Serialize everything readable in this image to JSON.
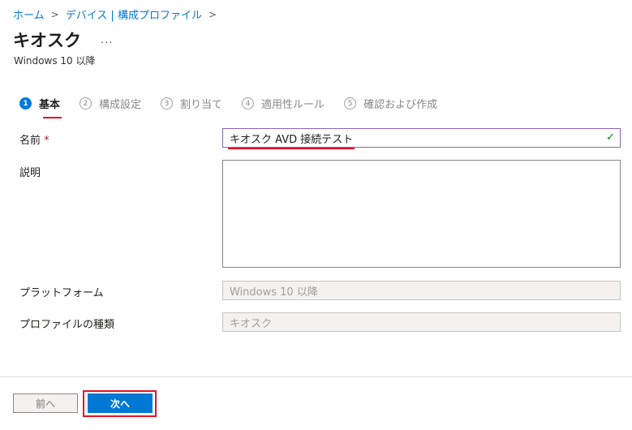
{
  "breadcrumb": {
    "items": [
      "ホーム",
      "デバイス | 構成プロファイル"
    ],
    "separator": ">"
  },
  "header": {
    "title": "キオスク",
    "more": "...",
    "subtitle": "Windows 10 以降"
  },
  "steps": [
    {
      "num": "1",
      "label": "基本",
      "active": true
    },
    {
      "num": "2",
      "label": "構成設定",
      "active": false
    },
    {
      "num": "3",
      "label": "割り当て",
      "active": false
    },
    {
      "num": "4",
      "label": "適用性ルール",
      "active": false
    },
    {
      "num": "5",
      "label": "確認および作成",
      "active": false
    }
  ],
  "form": {
    "name_label": "名前",
    "required_mark": "*",
    "name_value": "キオスク AVD 接続テスト",
    "valid_check": "✓",
    "description_label": "説明",
    "description_value": "",
    "platform_label": "プラットフォーム",
    "platform_value": "Windows 10 以降",
    "profile_type_label": "プロファイルの種類",
    "profile_type_value": "キオスク"
  },
  "footer": {
    "prev_label": "前へ",
    "next_label": "次へ"
  },
  "colors": {
    "accent": "#0078d4",
    "highlight": "#e81123",
    "valid": "#107c10"
  }
}
